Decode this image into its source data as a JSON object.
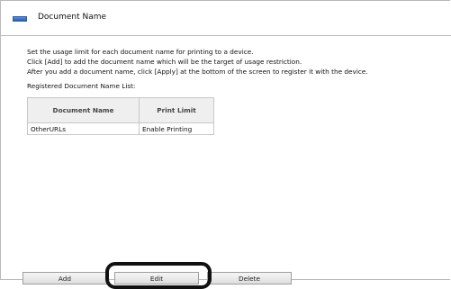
{
  "header": {
    "title": "Document Name",
    "icon": "document-icon"
  },
  "description": {
    "line1": "Set the usage limit for each document name for printing to a device.",
    "line2": "Click [Add] to add the document name which will be the target of usage restriction.",
    "line3": "After you add a document name, click [Apply] at the bottom of the screen to register it with the device.",
    "list_label": "Registered Document Name List:"
  },
  "table": {
    "columns": [
      "Document Name",
      "Print Limit"
    ],
    "rows": [
      [
        "OtherURLs",
        "Enable Printing"
      ]
    ]
  },
  "buttons": {
    "add": "Add",
    "edit": "Edit",
    "delete": "Delete"
  },
  "colors": {
    "header_icon": "#2a5fae",
    "highlight": "#111111"
  }
}
